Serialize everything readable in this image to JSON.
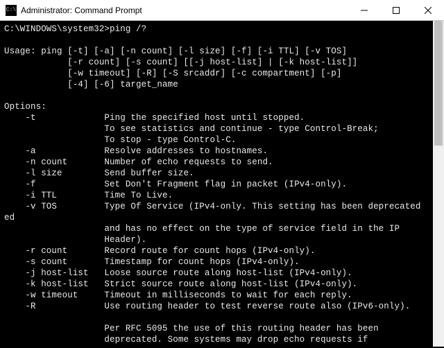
{
  "window": {
    "title": "Administrator: Command Prompt",
    "icon_glyph": "C:\\"
  },
  "prompt": {
    "path": "C:\\WINDOWS\\system32>",
    "command": "ping /?"
  },
  "usage": {
    "label": "Usage:",
    "lines": [
      "ping [-t] [-a] [-n count] [-l size] [-f] [-i TTL] [-v TOS]",
      "[-r count] [-s count] [[-j host-list] | [-k host-list]]",
      "[-w timeout] [-R] [-S srcaddr] [-c compartment] [-p]",
      "[-4] [-6] target_name"
    ]
  },
  "options_header": "Options:",
  "options": [
    {
      "flag": "-t",
      "desc": [
        "Ping the specified host until stopped.",
        "To see statistics and continue - type Control-Break;",
        "To stop - type Control-C."
      ]
    },
    {
      "flag": "-a",
      "desc": [
        "Resolve addresses to hostnames."
      ]
    },
    {
      "flag": "-n count",
      "desc": [
        "Number of echo requests to send."
      ]
    },
    {
      "flag": "-l size",
      "desc": [
        "Send buffer size."
      ]
    },
    {
      "flag": "-f",
      "desc": [
        "Set Don't Fragment flag in packet (IPv4-only)."
      ]
    },
    {
      "flag": "-i TTL",
      "desc": [
        "Time To Live."
      ]
    },
    {
      "flag": "-v TOS",
      "desc": [
        "Type Of Service (IPv4-only. This setting has been deprecated",
        "and has no effect on the type of service field in the IP",
        "Header)."
      ],
      "wrap_prefix": "ed"
    },
    {
      "flag": "-r count",
      "desc": [
        "Record route for count hops (IPv4-only)."
      ]
    },
    {
      "flag": "-s count",
      "desc": [
        "Timestamp for count hops (IPv4-only)."
      ]
    },
    {
      "flag": "-j host-list",
      "desc": [
        "Loose source route along host-list (IPv4-only)."
      ]
    },
    {
      "flag": "-k host-list",
      "desc": [
        "Strict source route along host-list (IPv4-only)."
      ]
    },
    {
      "flag": "-w timeout",
      "desc": [
        "Timeout in milliseconds to wait for each reply."
      ]
    },
    {
      "flag": "-R",
      "desc": [
        "Use routing header to test reverse route also (IPv6-only).",
        "",
        "Per RFC 5095 the use of this routing header has been",
        "deprecated. Some systems may drop echo requests if"
      ]
    }
  ]
}
